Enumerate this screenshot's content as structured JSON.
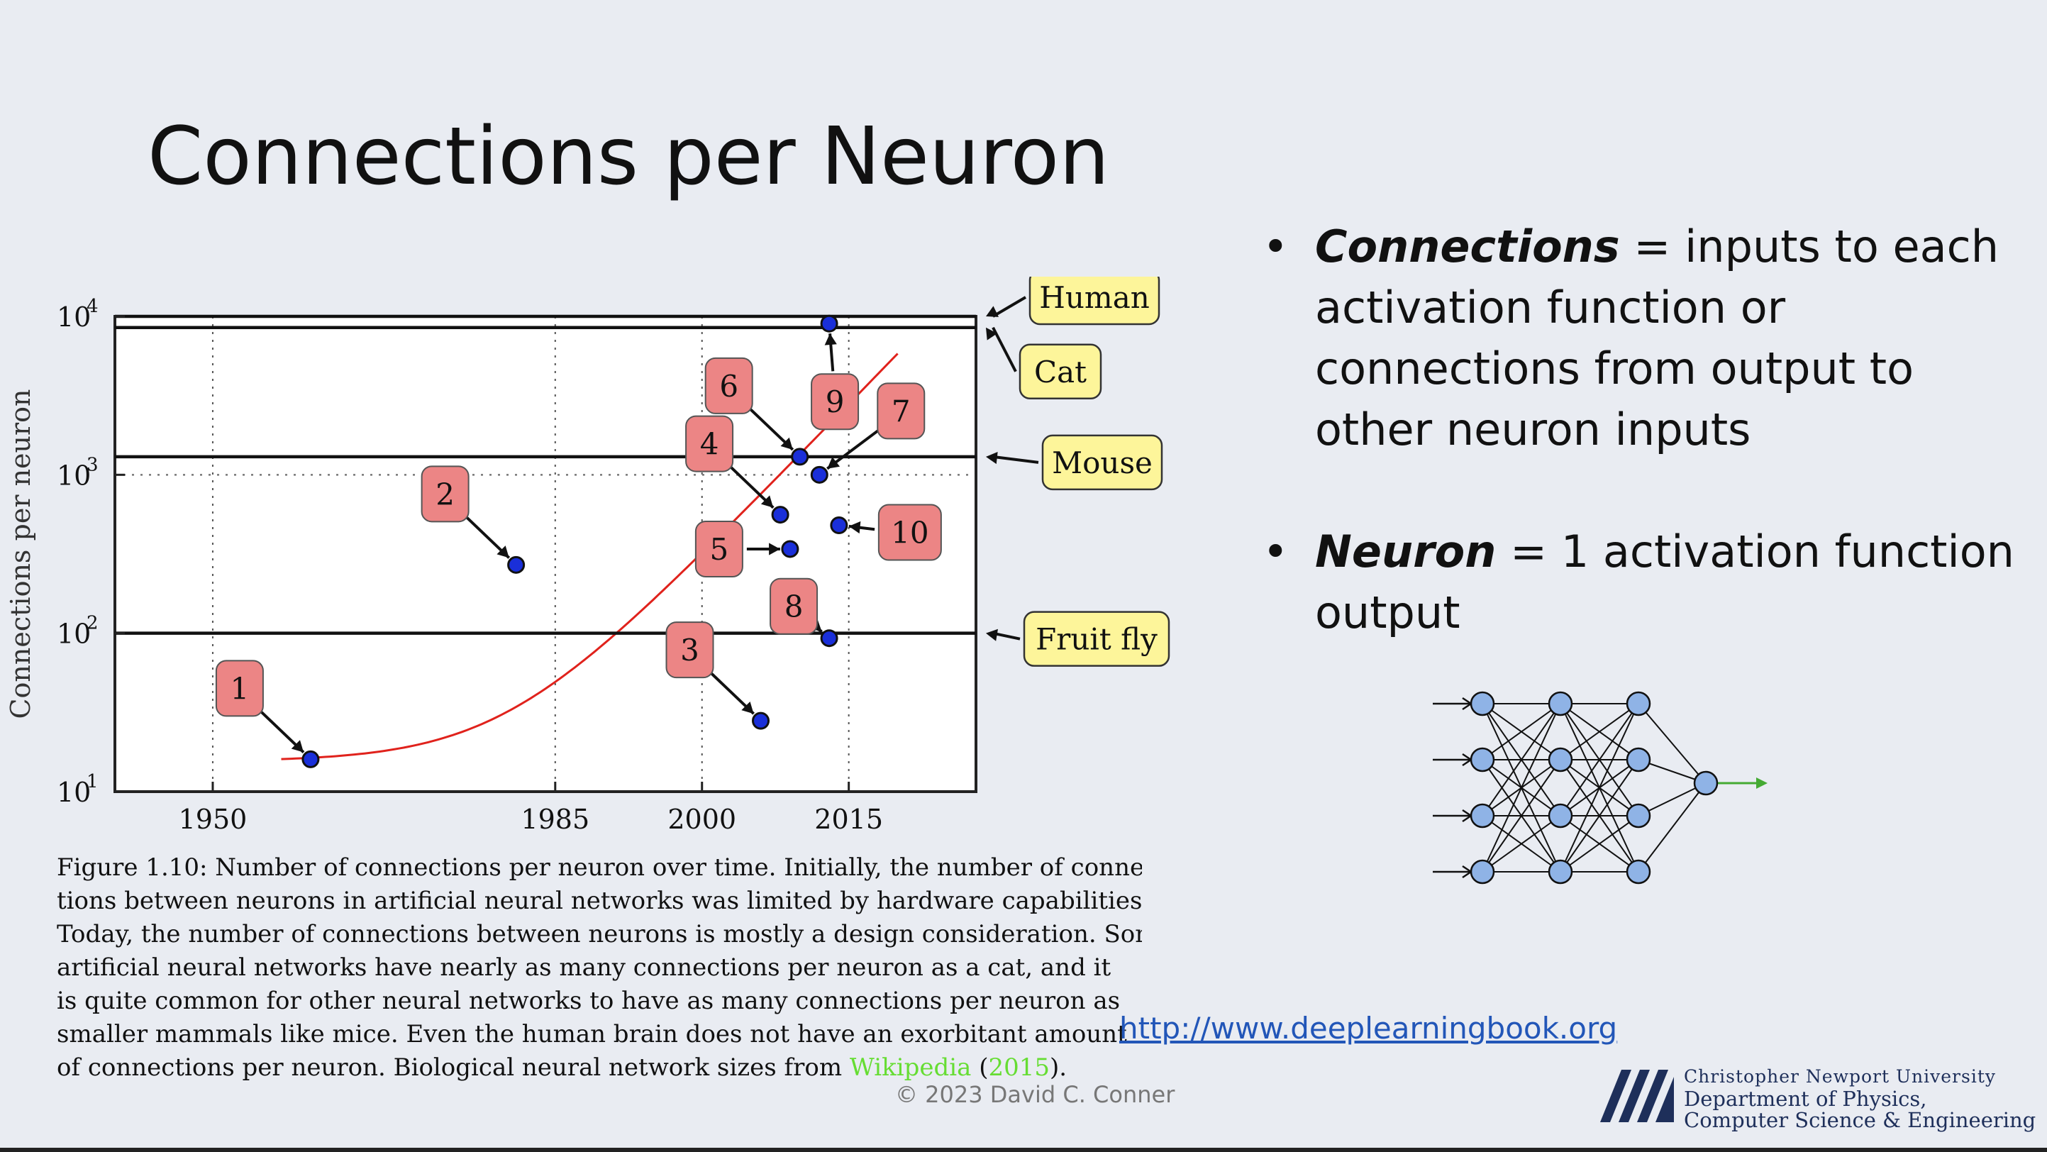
{
  "slide": {
    "title": "Connections per Neuron",
    "bullets": [
      {
        "term": "Connections",
        "text": " = inputs to each activation function or connections from output to other neuron inputs"
      },
      {
        "term": "Neuron",
        "text": " = 1 activation function output"
      }
    ],
    "link": "http://www.deeplearningbook.org",
    "copyright": "© 2023 David C. Conner",
    "logo": {
      "line1": "Christopher Newport University",
      "line2": "Department of Physics,",
      "line3": "Computer Science & Engineering"
    }
  },
  "figure": {
    "caption_lines": [
      "Figure 1.10: Number of connections per neuron over time. Initially, the number of connec-",
      "tions between neurons in artificial neural networks was limited by hardware capabilities.",
      "Today, the number of connections between neurons is mostly a design consideration. Some",
      "artificial neural networks have nearly as many connections per neuron as a cat, and it",
      "is quite common for other neural networks to have as many connections per neuron as",
      "smaller mammals like mice. Even the human brain does not have an exorbitant amount"
    ],
    "caption_last_prefix": "of connections per neuron. Biological neural network sizes from ",
    "caption_cite_name": "Wikipedia",
    "caption_open": " (",
    "caption_cite_year": "2015",
    "caption_close": ")."
  },
  "chart_data": {
    "type": "scatter",
    "title": "",
    "xlabel": "",
    "ylabel": "Connections per neuron",
    "y_scale": "log",
    "xlim": [
      1940,
      2028
    ],
    "ylim": [
      10,
      10000
    ],
    "x_ticks": [
      "1950",
      "1985",
      "2000",
      "2015"
    ],
    "y_ticks": [
      "10",
      "10",
      "10",
      "10"
    ],
    "y_tick_exponents": [
      "1",
      "2",
      "3",
      "4"
    ],
    "grid": true,
    "points": [
      {
        "label": "1",
        "x": 1960,
        "y": 16
      },
      {
        "label": "2",
        "x": 1981,
        "y": 270
      },
      {
        "label": "3",
        "x": 2006,
        "y": 28
      },
      {
        "label": "4",
        "x": 2008,
        "y": 560
      },
      {
        "label": "5",
        "x": 2009,
        "y": 340
      },
      {
        "label": "6",
        "x": 2010,
        "y": 1300
      },
      {
        "label": "7",
        "x": 2012,
        "y": 1000
      },
      {
        "label": "8",
        "x": 2013,
        "y": 93
      },
      {
        "label": "9",
        "x": 2013,
        "y": 9000
      },
      {
        "label": "10",
        "x": 2014,
        "y": 480
      }
    ],
    "reference_lines": [
      {
        "name": "Human",
        "y": 10000
      },
      {
        "name": "Cat",
        "y": 8500
      },
      {
        "name": "Mouse",
        "y": 1300
      },
      {
        "name": "Fruit fly",
        "y": 100
      }
    ],
    "dotted_level": 1000,
    "trend": "exponential",
    "colors": {
      "point": "#1a2fd9",
      "label_box": "#ec8585",
      "ref_box": "#fdf59a",
      "trend": "#e0221c"
    }
  },
  "network_diagram": {
    "layers": [
      4,
      4,
      4,
      1
    ],
    "node_color": "#8fb3e6",
    "output_arrow_color": "#44aa33"
  }
}
